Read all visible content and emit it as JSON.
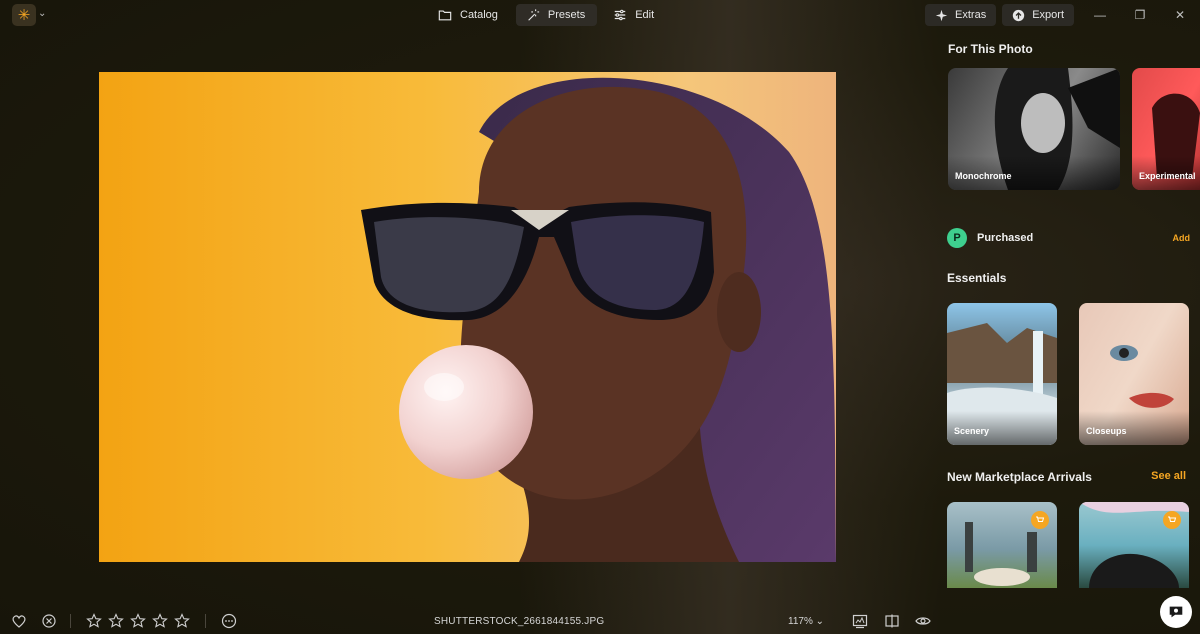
{
  "app": {
    "logo_glyph": "✳",
    "accent": "#f5a623"
  },
  "nav": {
    "tabs": [
      {
        "label": "Catalog",
        "icon": "folder-icon",
        "active": false
      },
      {
        "label": "Presets",
        "icon": "magic-wand-icon",
        "active": true
      },
      {
        "label": "Edit",
        "icon": "sliders-icon",
        "active": false
      }
    ]
  },
  "toolbar": {
    "extras_label": "Extras",
    "export_label": "Export"
  },
  "window": {
    "minimize": "—",
    "restore": "❐",
    "close": "✕"
  },
  "panel": {
    "for_this_photo": {
      "title": "For This Photo",
      "cards": [
        {
          "label": "Monochrome"
        },
        {
          "label": "Experimental"
        }
      ]
    },
    "purchased": {
      "label": "Purchased",
      "icon_glyph": "P",
      "add_label": "Add"
    },
    "essentials": {
      "title": "Essentials",
      "cards": [
        {
          "label": "Scenery"
        },
        {
          "label": "Closeups"
        }
      ]
    },
    "marketplace": {
      "title": "New Marketplace Arrivals",
      "see_all_label": "See all"
    }
  },
  "bottom": {
    "filename": "SHUTTERSTOCK_2661844155.JPG",
    "zoom": "117% ⌄",
    "rating_stars": 5,
    "rating_value": 0
  }
}
